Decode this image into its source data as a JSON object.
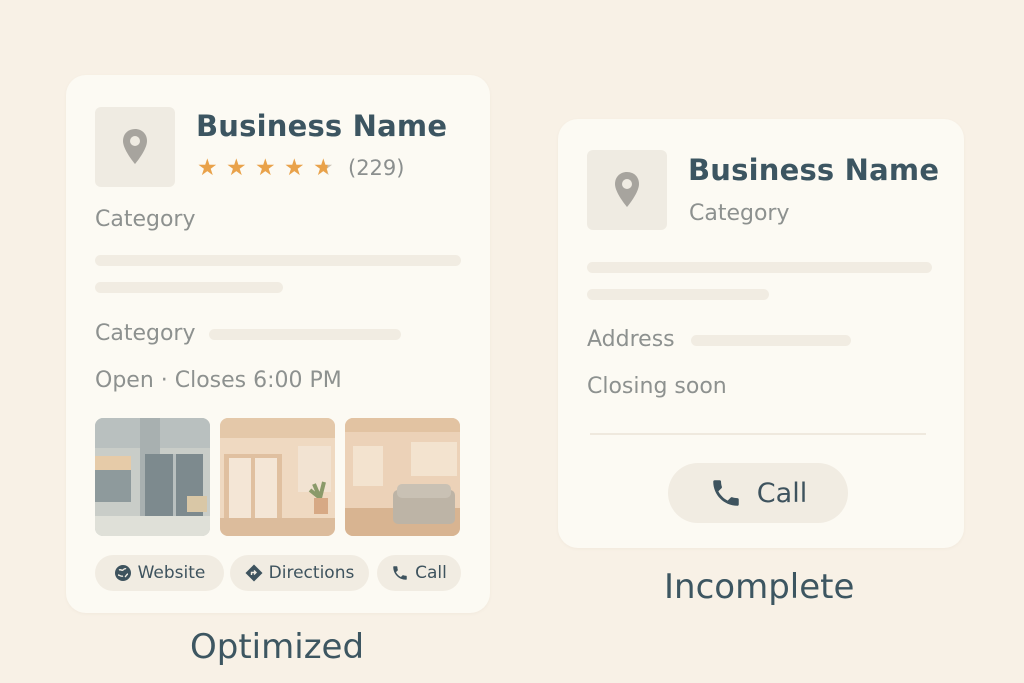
{
  "optimized": {
    "business_name": "Business Name",
    "rating": 4.5,
    "review_count": "(229)",
    "category_1": "Category",
    "category_2": "Category",
    "hours": "Open · Closes 6:00 PM",
    "buttons": {
      "website": "Website",
      "directions": "Directions",
      "call": "Call"
    },
    "caption": "Optimized"
  },
  "incomplete": {
    "business_name": "Business Name",
    "category": "Category",
    "address_label": "Address",
    "status": "Closing soon",
    "call_label": "Call",
    "caption": "Incomplete"
  },
  "colors": {
    "background": "#f8f1e6",
    "card": "#fcfaf3",
    "star": "#e9a24a",
    "text_dark": "#3c5561",
    "text_muted": "#8d918f"
  },
  "icons": [
    "location-pin-icon",
    "star-icon",
    "globe-icon",
    "directions-icon",
    "phone-icon"
  ]
}
